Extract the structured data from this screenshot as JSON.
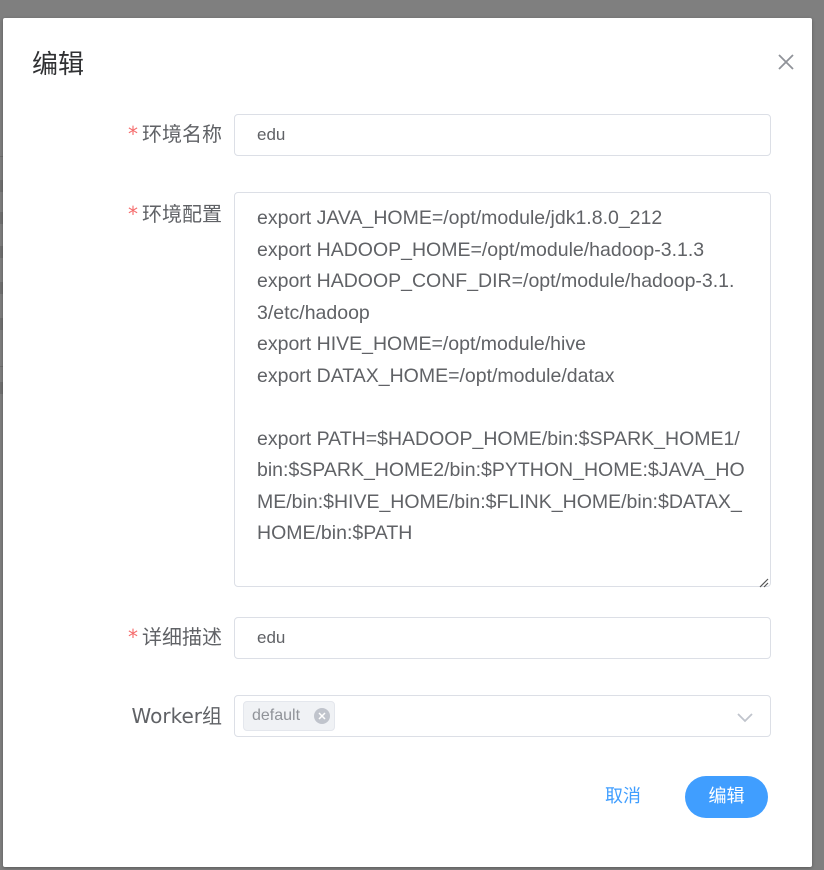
{
  "dialog": {
    "title": "编辑",
    "close_icon": "close-icon"
  },
  "form": {
    "env_name": {
      "label": "环境名称",
      "required_mark": "*",
      "value": "edu"
    },
    "env_config": {
      "label": "环境配置",
      "required_mark": "*",
      "value": "export JAVA_HOME=/opt/module/jdk1.8.0_212\nexport HADOOP_HOME=/opt/module/hadoop-3.1.3\nexport HADOOP_CONF_DIR=/opt/module/hadoop-3.1.3/etc/hadoop\nexport HIVE_HOME=/opt/module/hive\nexport DATAX_HOME=/opt/module/datax\n\nexport PATH=$HADOOP_HOME/bin:$SPARK_HOME1/bin:$SPARK_HOME2/bin:$PYTHON_HOME:$JAVA_HOME/bin:$HIVE_HOME/bin:$FLINK_HOME/bin:$DATAX_HOME/bin:$PATH"
    },
    "description": {
      "label": "详细描述",
      "required_mark": "*",
      "value": "edu"
    },
    "worker_group": {
      "label": "Worker组",
      "selected_tag": "default",
      "arrow_icon": "chevron-down-icon"
    }
  },
  "footer": {
    "cancel_label": "取消",
    "submit_label": "编辑"
  },
  "colors": {
    "primary": "#409eff",
    "required": "#f56c6c",
    "overlay": "#7f7f7f"
  }
}
